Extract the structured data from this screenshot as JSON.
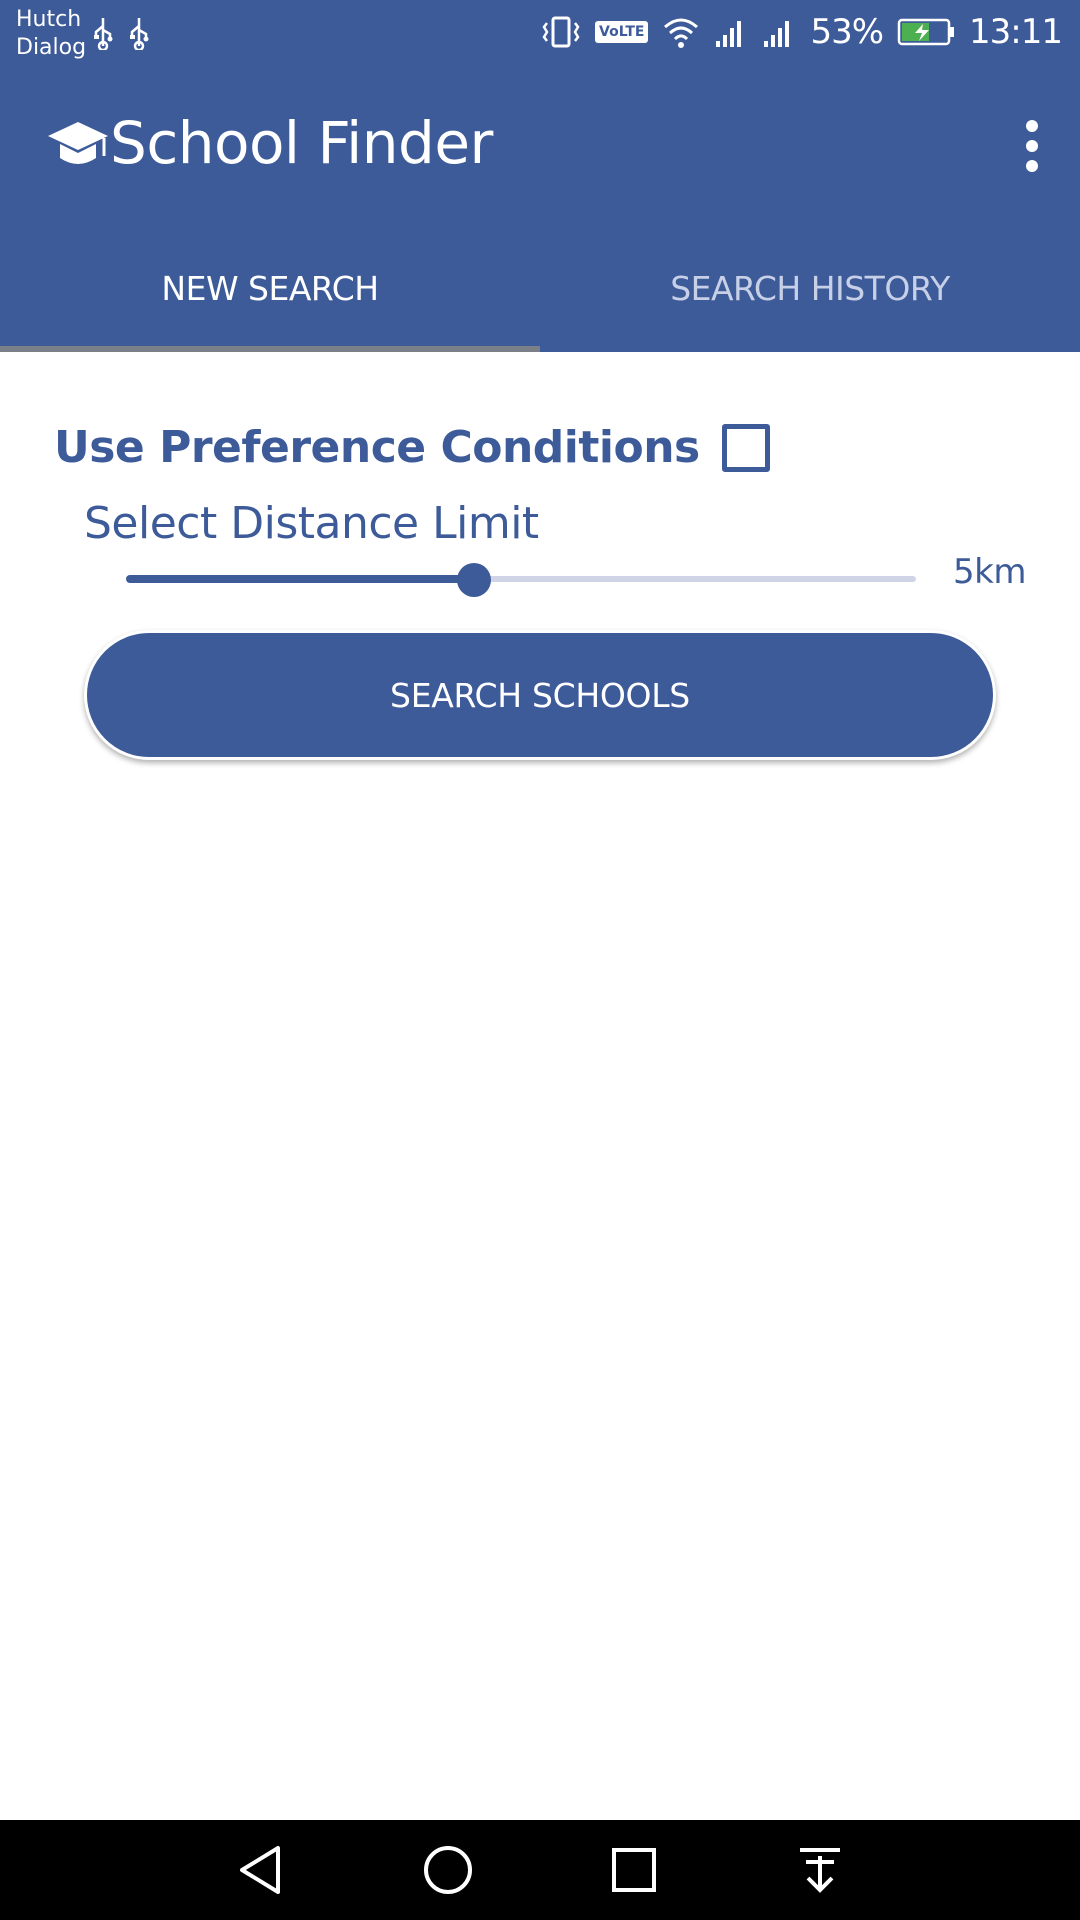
{
  "status_bar": {
    "carrier_1": "Hutch",
    "carrier_2": "Dialog",
    "volte": "VoLTE",
    "battery_percent": "53%",
    "time": "13:11"
  },
  "app_bar": {
    "title": "School Finder",
    "logo_icon": "graduation-cap-icon",
    "menu_icon": "more-vert-icon"
  },
  "tabs": [
    {
      "label": "NEW SEARCH",
      "active": true
    },
    {
      "label": "SEARCH HISTORY",
      "active": false
    }
  ],
  "form": {
    "preference_label": "Use Preference Conditions",
    "preference_checked": false,
    "distance_label": "Select Distance Limit",
    "distance_value": "5km",
    "distance_slider_fraction": 0.44,
    "search_button_label": "SEARCH SCHOOLS"
  },
  "nav_bar": {
    "back_icon": "back-triangle-icon",
    "home_icon": "home-circle-icon",
    "recents_icon": "recents-square-icon",
    "notification_icon": "pull-down-icon"
  },
  "colors": {
    "primary": "#3d5a99",
    "tab_inactive": "#c7d0e6",
    "tab_indicator": "#7b7f88",
    "slider_track": "#cfd5e6"
  }
}
